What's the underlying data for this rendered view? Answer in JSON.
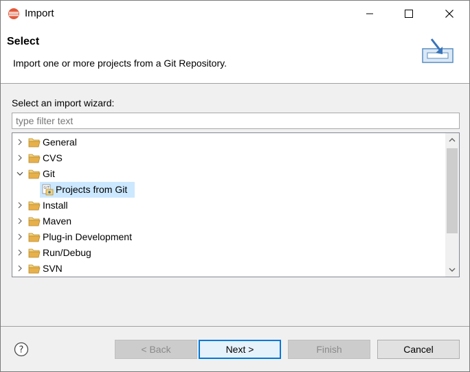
{
  "window": {
    "title": "Import"
  },
  "banner": {
    "title": "Select",
    "description": "Import one or more projects from a Git Repository."
  },
  "wizard": {
    "label": "Select an import wizard:",
    "filter_placeholder": "type filter text",
    "filter_value": ""
  },
  "tree": {
    "items": [
      {
        "label": "General",
        "expanded": false
      },
      {
        "label": "CVS",
        "expanded": false
      },
      {
        "label": "Git",
        "expanded": true
      },
      {
        "label": "Projects from Git",
        "child": true,
        "selected": true
      },
      {
        "label": "Install",
        "expanded": false
      },
      {
        "label": "Maven",
        "expanded": false
      },
      {
        "label": "Plug-in Development",
        "expanded": false
      },
      {
        "label": "Run/Debug",
        "expanded": false
      },
      {
        "label": "SVN",
        "expanded": false
      }
    ]
  },
  "buttons": {
    "back": "< Back",
    "next": "Next >",
    "finish": "Finish",
    "cancel": "Cancel"
  },
  "colors": {
    "selection": "#cce8ff",
    "default_border": "#0078d7",
    "folder": "#e8b04a"
  }
}
